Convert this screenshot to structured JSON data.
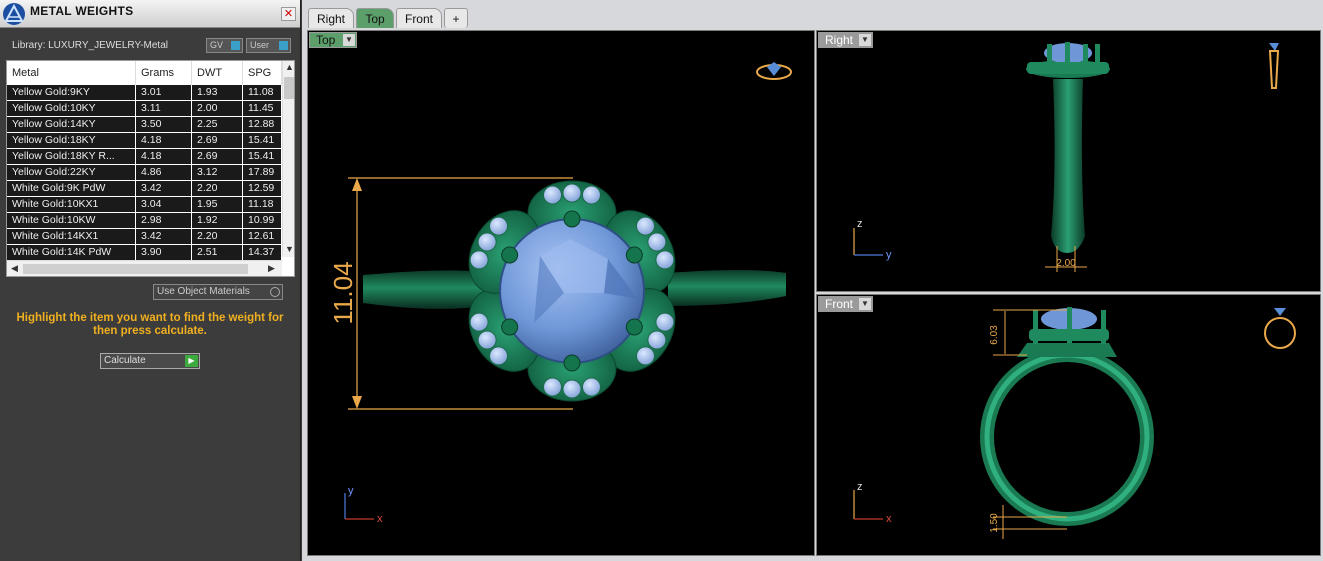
{
  "panel": {
    "title": "METAL WEIGHTS",
    "close": "✕",
    "library": "Library: LUXURY_JEWELRY-Metal",
    "toggle_gv": "GV",
    "toggle_user": "User",
    "use_object_materials": "Use Object Materials",
    "hint": "Highlight the item you want to find the weight for then press calculate.",
    "calculate": "Calculate"
  },
  "table": {
    "headers": [
      "Metal",
      "Grams",
      "DWT",
      "SPG"
    ],
    "rows": [
      [
        "Yellow Gold:9KY",
        "3.01",
        "1.93",
        "11.08"
      ],
      [
        "Yellow Gold:10KY",
        "3.11",
        "2.00",
        "11.45"
      ],
      [
        "Yellow Gold:14KY",
        "3.50",
        "2.25",
        "12.88"
      ],
      [
        "Yellow Gold:18KY",
        "4.18",
        "2.69",
        "15.41"
      ],
      [
        "Yellow Gold:18KY R...",
        "4.18",
        "2.69",
        "15.41"
      ],
      [
        "Yellow Gold:22KY",
        "4.86",
        "3.12",
        "17.89"
      ],
      [
        "White Gold:9K PdW",
        "3.42",
        "2.20",
        "12.59"
      ],
      [
        "White Gold:10KX1",
        "3.04",
        "1.95",
        "11.18"
      ],
      [
        "White Gold:10KW",
        "2.98",
        "1.92",
        "10.99"
      ],
      [
        "White Gold:14KX1",
        "3.42",
        "2.20",
        "12.61"
      ],
      [
        "White Gold:14K PdW",
        "3.90",
        "2.51",
        "14.37"
      ]
    ]
  },
  "tabs": [
    "Right",
    "Top",
    "Front",
    "+"
  ],
  "viewports": {
    "top": {
      "label": "Top",
      "dimension": "11.04",
      "axis_y": "y",
      "axis_x": "x"
    },
    "right": {
      "label": "Right",
      "dimension": "2.00",
      "axis_z": "z",
      "axis_y": "y"
    },
    "front": {
      "label": "Front",
      "dimension_top": "6.03",
      "dimension_bottom": "1.50",
      "axis_z": "z",
      "axis_x": "x"
    }
  },
  "colors": {
    "accent": "#5c9f6a",
    "ring": "#1f8a5e",
    "stone": "#6f97d8",
    "dimension": "#e9a94a"
  }
}
